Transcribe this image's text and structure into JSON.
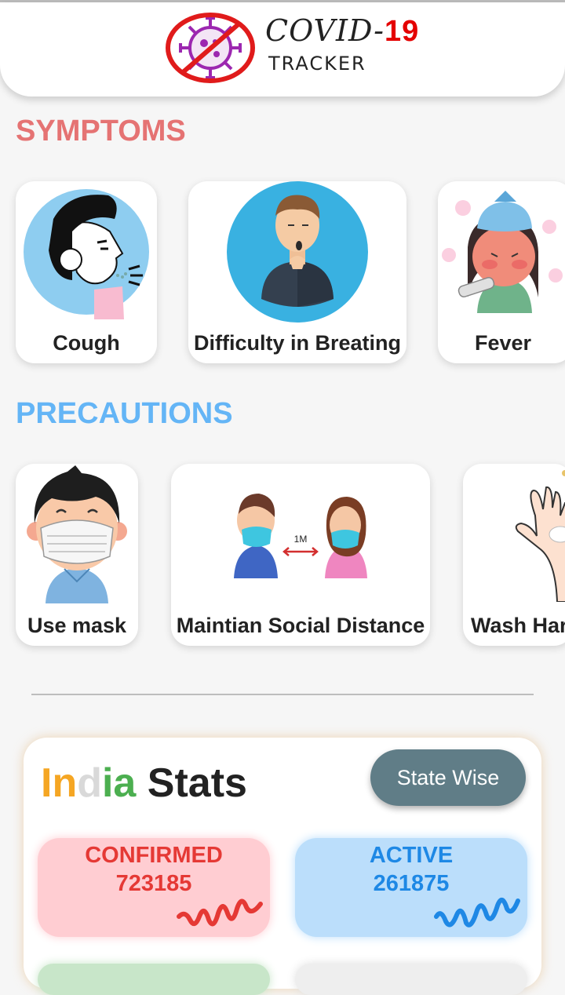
{
  "header": {
    "logo_title": "COVID-",
    "logo_number": "19",
    "logo_subtitle": "TRACKER",
    "logo_icon": "virus-crossed-icon"
  },
  "symptoms": {
    "title": "SYMPTOMS",
    "color": "#e57373",
    "items": [
      {
        "label": "Cough",
        "icon": "cough-illustration"
      },
      {
        "label": "Difficulty in Breating",
        "icon": "breathing-difficulty-illustration"
      },
      {
        "label": "Fever",
        "icon": "fever-illustration"
      }
    ]
  },
  "precautions": {
    "title": "PRECAUTIONS",
    "color": "#64b5f6",
    "items": [
      {
        "label": "Use mask",
        "icon": "mask-illustration"
      },
      {
        "label": "Maintian Social Distance",
        "icon": "social-distance-illustration",
        "distance_tag": "1M"
      },
      {
        "label": "Wash Har",
        "icon": "wash-hands-illustration"
      }
    ]
  },
  "stats": {
    "title_in": "In",
    "title_d": "d",
    "title_ia": "ia",
    "title_rest": " Stats",
    "state_button": "State Wise",
    "tiles": [
      {
        "label": "CONFIRMED",
        "value": "723185",
        "color": "#e53935",
        "bg": "#ffcdd2"
      },
      {
        "label": "ACTIVE",
        "value": "261875",
        "color": "#1e88e5",
        "bg": "#bbdefb"
      }
    ],
    "colors": {
      "saffron": "#f5a623",
      "white": "#d9d9d9",
      "green": "#4caf50"
    }
  }
}
